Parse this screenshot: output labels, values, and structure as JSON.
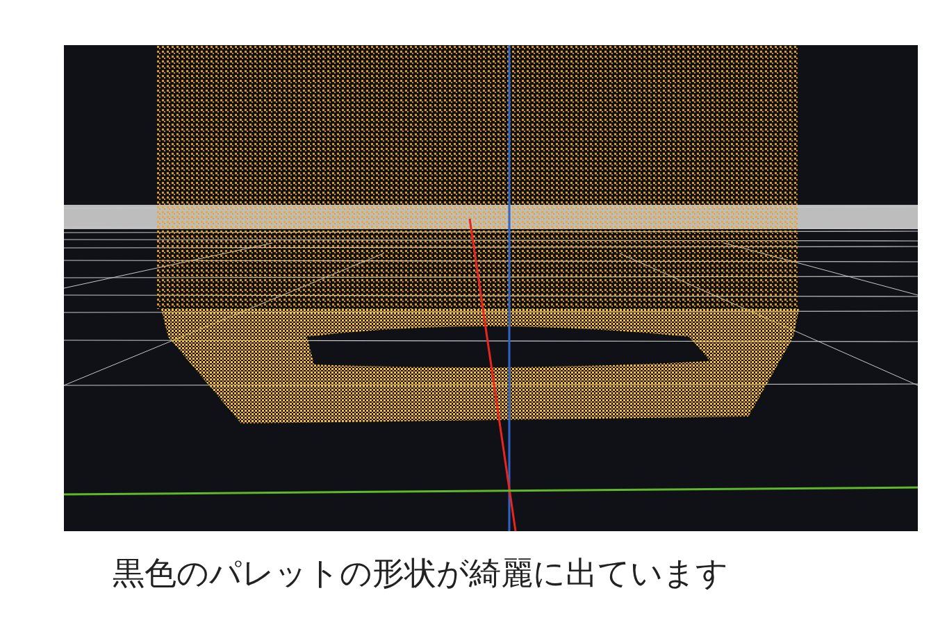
{
  "caption": "黒色のパレットの形状が綺麗に出ています"
}
